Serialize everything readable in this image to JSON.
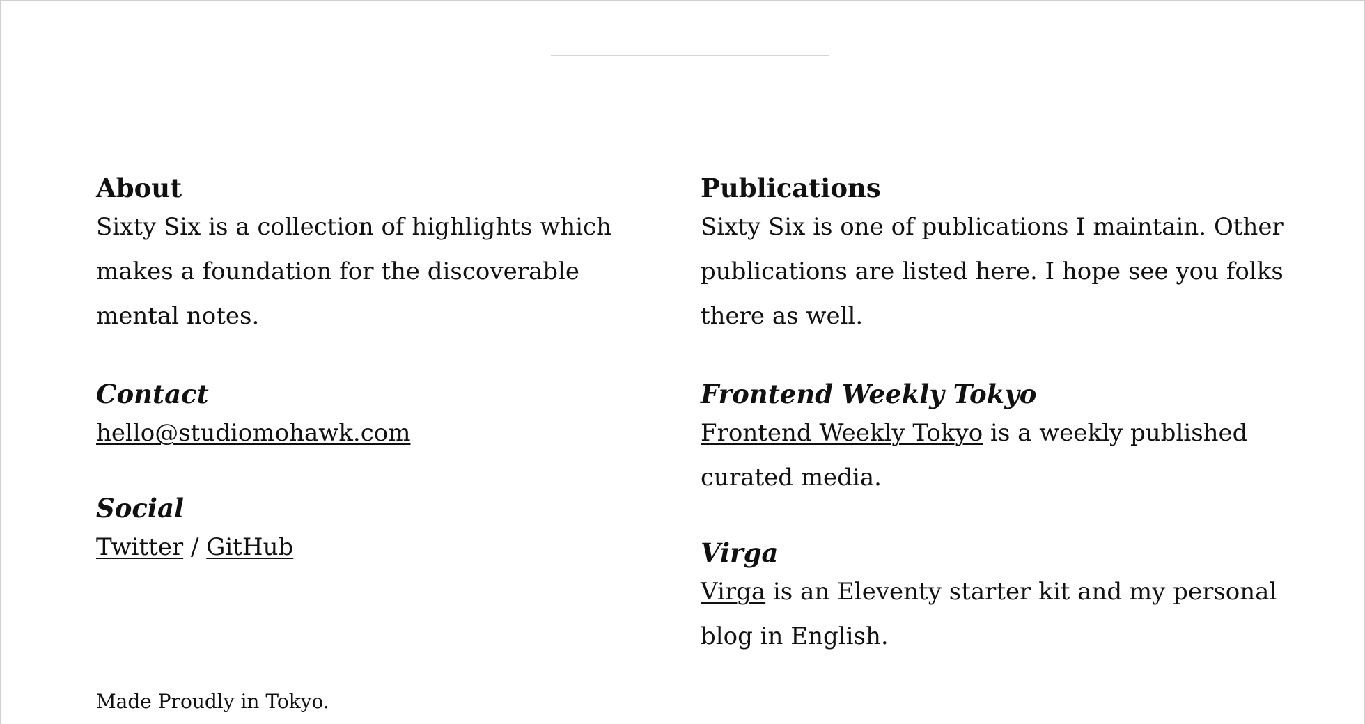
{
  "about": {
    "heading": "About",
    "text": "Sixty Six is a collection of highlights which makes a foundation for the discoverable mental notes."
  },
  "contact": {
    "heading": "Contact",
    "email": "hello@studiomohawk.com"
  },
  "social": {
    "heading": "Social",
    "twitter": "Twitter",
    "separator": " / ",
    "github": "GitHub"
  },
  "publications": {
    "heading": "Publications",
    "text": "Sixty Six is one of publications I maintain. Other publications are listed here. I hope see you folks there as well.",
    "items": [
      {
        "title": "Frontend Weekly Tokyo",
        "link": "Frontend Weekly Tokyo",
        "desc": " is a weekly published curated media."
      },
      {
        "title": "Virga",
        "link": "Virga",
        "desc": " is an Eleventy starter kit and my personal blog in English."
      }
    ]
  },
  "footer": {
    "note": "Made Proudly in Tokyo."
  }
}
